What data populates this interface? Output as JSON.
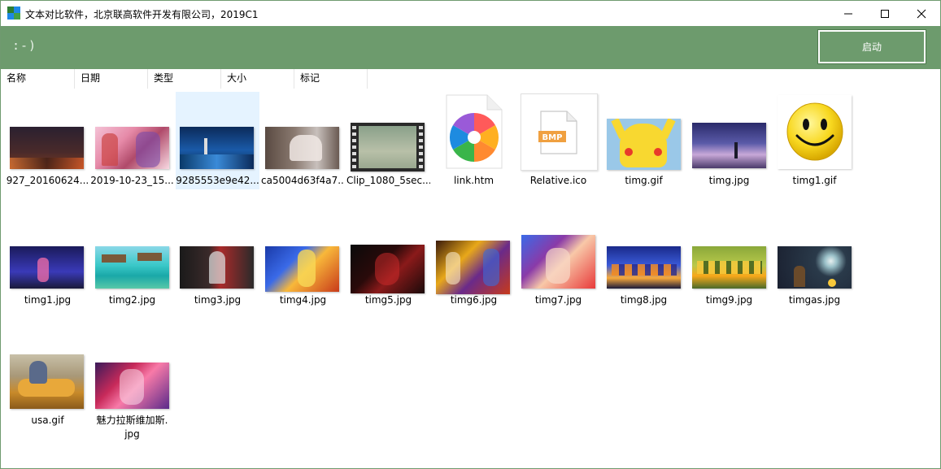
{
  "window": {
    "title": "文本对比软件，北京联高软件开发有限公司，2019C1",
    "icon": "app-grid-icon"
  },
  "toolbar": {
    "status_text": ":-)",
    "start_label": "启动"
  },
  "columns": [
    "名称",
    "日期",
    "类型",
    "大小",
    "标记"
  ],
  "files": [
    {
      "name": "927_20160624...",
      "kind": "image-dark-city"
    },
    {
      "name": "2019-10-23_15...",
      "kind": "image-anime-banner"
    },
    {
      "name": "9285553e9e42...",
      "kind": "image-blue-sea",
      "selected": true
    },
    {
      "name": "ca5004d63f4a7...",
      "kind": "image-photo"
    },
    {
      "name": "Clip_1080_5sec...",
      "kind": "video-film-icon"
    },
    {
      "name": "link.htm",
      "kind": "htm-pinwheel-icon"
    },
    {
      "name": "Relative.ico",
      "kind": "bmp-file-icon"
    },
    {
      "name": "timg.gif",
      "kind": "image-pikachu"
    },
    {
      "name": "timg.jpg",
      "kind": "image-night-sky"
    },
    {
      "name": "timg1.gif",
      "kind": "smiley-face-icon"
    },
    {
      "name": "timg1.jpg",
      "kind": "image-night-girl"
    },
    {
      "name": "timg2.jpg",
      "kind": "image-tropical"
    },
    {
      "name": "timg3.jpg",
      "kind": "image-assassin"
    },
    {
      "name": "timg4.jpg",
      "kind": "image-anime-fire"
    },
    {
      "name": "timg5.jpg",
      "kind": "image-dark-red"
    },
    {
      "name": "timg6.jpg",
      "kind": "image-fighters"
    },
    {
      "name": "timg7.jpg",
      "kind": "image-kof"
    },
    {
      "name": "timg8.jpg",
      "kind": "image-dragonball"
    },
    {
      "name": "timg9.jpg",
      "kind": "image-dragonball-green"
    },
    {
      "name": "timgas.jpg",
      "kind": "image-moon-night"
    },
    {
      "name": "usa.gif",
      "kind": "image-tom-cat"
    },
    {
      "name": "魅力拉斯维加斯.",
      "name2": "jpg",
      "kind": "image-game-girl"
    }
  ],
  "colors": {
    "toolbar_green": "#6d9b6d",
    "selection": "#e5f3ff"
  }
}
